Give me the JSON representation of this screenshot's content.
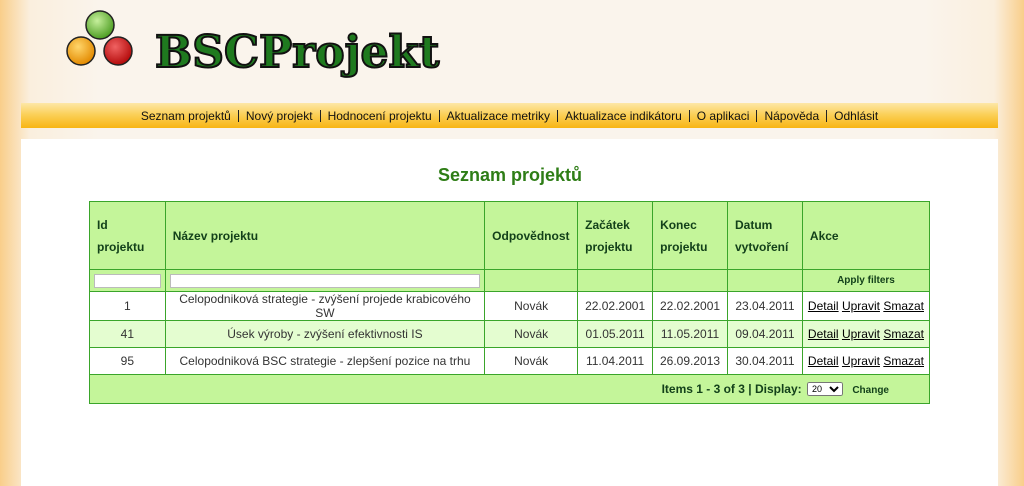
{
  "logo": {
    "text": "BSCProjekt",
    "alt": "BSCProjekt",
    "circle_colors": [
      "#8fd16a",
      "#f5a623",
      "#cc1f1f"
    ]
  },
  "menu": [
    "Seznam projektů",
    "Nový projekt",
    "Hodnocení projektu",
    "Aktualizace metriky",
    "Aktualizace indikátoru",
    "O aplikaci",
    "Nápověda",
    "Odhlásit"
  ],
  "page_title": "Seznam projektů",
  "table": {
    "headers": {
      "id": "Id projektu",
      "name": "Název projektu",
      "resp": "Odpovědnost",
      "start": "Začátek projektu",
      "end": "Konec projektu",
      "created": "Datum vytvoření",
      "actions": "Akce"
    },
    "apply_filters": "Apply filters",
    "rows": [
      {
        "id": "1",
        "name": "Celopodniková strategie - zvýšení projede krabicového SW",
        "resp": "Novák",
        "start": "22.02.2001",
        "end": "22.02.2001",
        "created": "23.04.2011"
      },
      {
        "id": "41",
        "name": "Úsek výroby - zvýšení efektivnosti IS",
        "resp": "Novák",
        "start": "01.05.2011",
        "end": "11.05.2011",
        "created": "09.04.2011"
      },
      {
        "id": "95",
        "name": "Celopodniková BSC strategie - zlepšení pozice na trhu",
        "resp": "Novák",
        "start": "11.04.2011",
        "end": "26.09.2013",
        "created": "30.04.2011"
      }
    ],
    "action_labels": {
      "detail": "Detail",
      "edit": "Upravit",
      "delete": "Smazat"
    },
    "footer": {
      "items_text": "Items 1 - 3 of 3 | Display:",
      "display_value": "20",
      "change": "Change"
    }
  },
  "colors": {
    "header_bg": "#c4f59a",
    "title_color": "#2e7d16",
    "menu_gradient": [
      "#fde7a7",
      "#f8b514"
    ],
    "border": "#3aa52a"
  }
}
